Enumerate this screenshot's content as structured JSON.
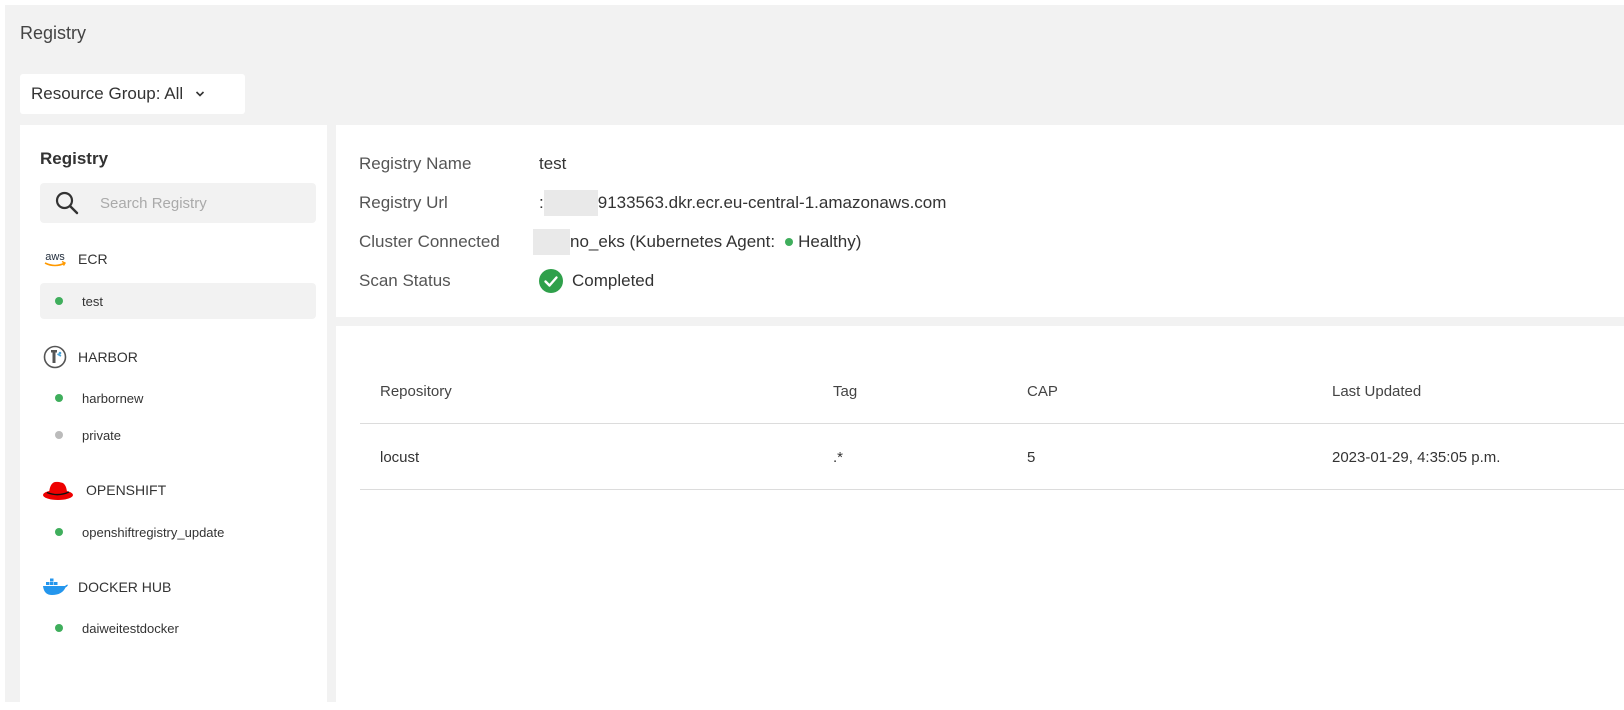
{
  "page": {
    "title": "Registry"
  },
  "resource_group": {
    "label": "Resource Group: All"
  },
  "sidebar": {
    "title": "Registry",
    "search_placeholder": "Search Registry",
    "groups": [
      {
        "name": "ECR",
        "icon": "aws-logo-icon",
        "icon_text": "aws",
        "items": [
          {
            "label": "test",
            "status": "green",
            "selected": true
          }
        ]
      },
      {
        "name": "HARBOR",
        "icon": "harbor-logo-icon",
        "items": [
          {
            "label": "harbornew",
            "status": "green"
          },
          {
            "label": "private",
            "status": "gray"
          }
        ]
      },
      {
        "name": "OPENSHIFT",
        "icon": "redhat-logo-icon",
        "items": [
          {
            "label": "openshiftregistry_update",
            "status": "green"
          }
        ]
      },
      {
        "name": "DOCKER HUB",
        "icon": "docker-logo-icon",
        "items": [
          {
            "label": "daiweitestdocker",
            "status": "green"
          }
        ]
      }
    ]
  },
  "details": {
    "registry_name_label": "Registry Name",
    "registry_name": "test",
    "registry_url_label": "Registry Url",
    "registry_url_prefix": ":",
    "registry_url": "9133563.dkr.ecr.eu-central-1.amazonaws.com",
    "cluster_label": "Cluster Connected",
    "cluster_name": "no_eks (Kubernetes Agent:",
    "cluster_health": "Healthy)",
    "scan_status_label": "Scan Status",
    "scan_status": "Completed"
  },
  "table": {
    "columns": [
      "Repository",
      "Tag",
      "CAP",
      "Last Updated"
    ],
    "rows": [
      [
        "locust",
        ".*",
        "5",
        "2023-01-29, 4:35:05 p.m."
      ]
    ]
  },
  "colors": {
    "status_green": "#3fae5c",
    "status_gray": "#bbbbbb",
    "check_green": "#2fa04b",
    "redhat_red": "#e00",
    "docker_blue": "#2496ed",
    "aws_orange": "#f90"
  }
}
